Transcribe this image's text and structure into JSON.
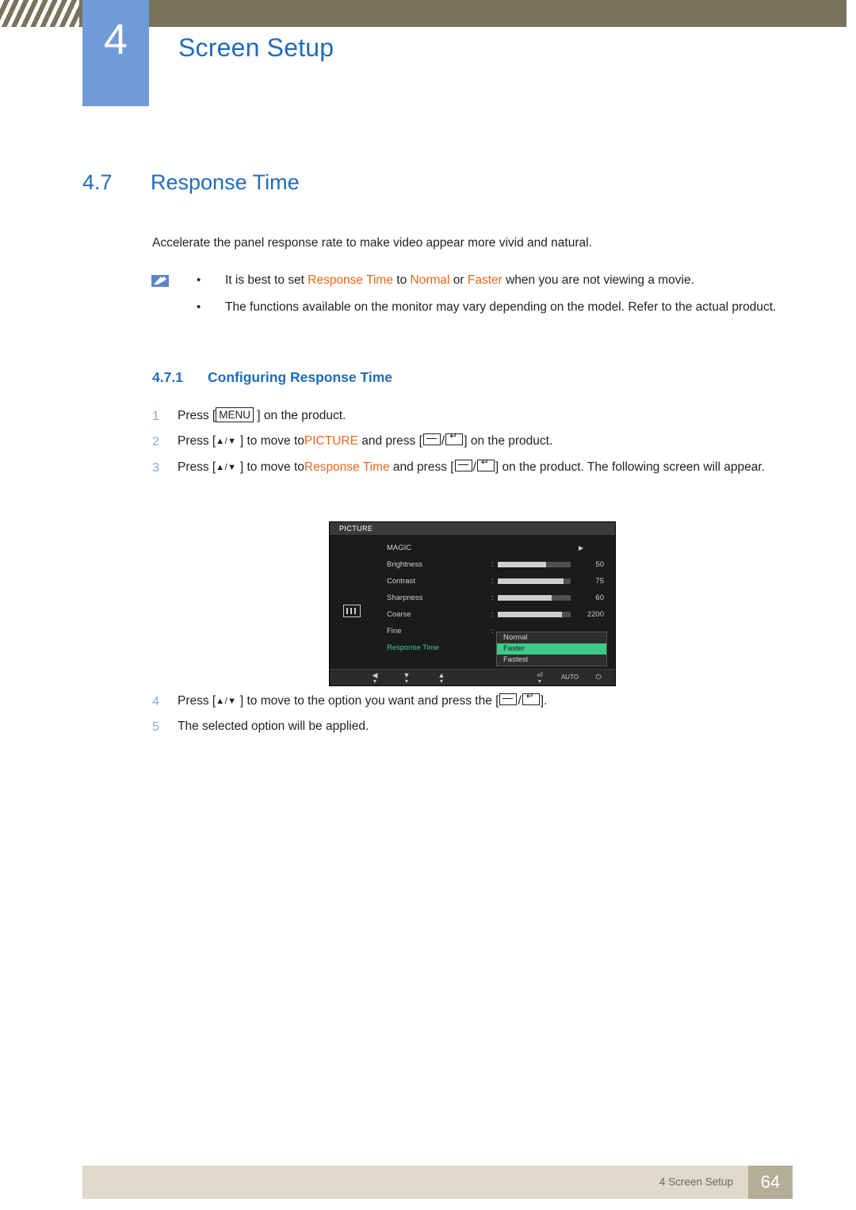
{
  "header": {
    "chapter_number": "4",
    "chapter_title": "Screen Setup"
  },
  "section": {
    "number": "4.7",
    "title": "Response Time"
  },
  "lead": "Accelerate the panel response rate to make video appear more vivid and natural.",
  "notes": {
    "icon": "note-pencil-icon",
    "items": [
      {
        "p1": "It is best to set ",
        "hl1": "Response Time",
        "p2": " to ",
        "hl2": "Normal",
        "p3": " or ",
        "hl3": "Faster",
        "p4": " when you are not viewing a movie."
      },
      {
        "text": "The functions available on the monitor may vary depending on the model. Refer to the actual product."
      }
    ]
  },
  "subsection": {
    "number": "4.7.1",
    "title": "Configuring Response Time"
  },
  "steps": [
    {
      "n": "1",
      "a": "Press [",
      "key": "MENU",
      "b": "] on the product."
    },
    {
      "n": "2",
      "a": "Press [",
      "arrows": "▲/▼",
      "b": "] to move to",
      "hl": "PICTURE",
      "c": " and press [",
      "d": "] on the product."
    },
    {
      "n": "3",
      "a": "Press [",
      "arrows": "▲/▼",
      "b": "] to move to",
      "hl": "Response Time",
      "c": " and press [",
      "d": "] on the product. The following screen will appear."
    },
    {
      "n": "4",
      "a": "Press [",
      "arrows": "▲/▼",
      "b": "] to move to the option you want and press the [",
      "d": "]."
    },
    {
      "n": "5",
      "text": "The selected option will be applied."
    }
  ],
  "osd": {
    "title": "PICTURE",
    "sidebar_icon": "picture-menu-icon",
    "rows": [
      {
        "label": "MAGIC",
        "type": "arrow",
        "value": "▶"
      },
      {
        "label": "Brightness",
        "type": "bar",
        "value": "50",
        "fill_pct": 66
      },
      {
        "label": "Contrast",
        "type": "bar",
        "value": "75",
        "fill_pct": 90
      },
      {
        "label": "Sharpness",
        "type": "bar",
        "value": "60",
        "fill_pct": 74
      },
      {
        "label": "Coarse",
        "type": "bar",
        "value": "2200",
        "fill_pct": 88
      },
      {
        "label": "Fine",
        "type": "plain",
        "value": ""
      },
      {
        "label": "Response Time",
        "type": "active",
        "value": ""
      }
    ],
    "popup": {
      "options": [
        "Normal",
        "Faster",
        "Fastest"
      ],
      "selected": "Faster"
    },
    "footer_buttons": [
      {
        "glyph": "◀",
        "sub": "▼",
        "name": "left-button"
      },
      {
        "glyph": "▼",
        "sub": "▼",
        "name": "down-button"
      },
      {
        "glyph": "▲",
        "sub": "▼",
        "name": "up-button"
      },
      {
        "glyph": "⏎",
        "sub": "▼",
        "name": "enter-button"
      },
      {
        "glyph": "AUTO",
        "sub": "",
        "name": "auto-button"
      },
      {
        "glyph": "⏻",
        "sub": "",
        "name": "power-button"
      }
    ]
  },
  "footer": {
    "text": "4 Screen Setup",
    "page": "64"
  }
}
